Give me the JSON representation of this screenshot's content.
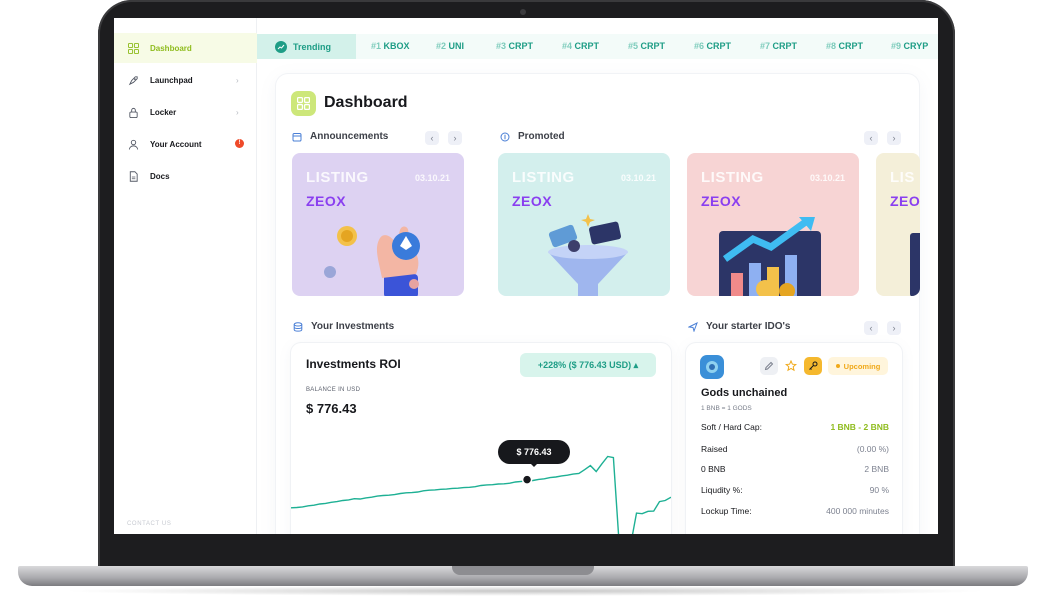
{
  "sidebar": {
    "items": [
      {
        "label": "Dashboard",
        "icon": "grid-icon",
        "active": true
      },
      {
        "label": "Launchpad",
        "icon": "rocket-icon",
        "chevron": "›"
      },
      {
        "label": "Locker",
        "icon": "lock-icon",
        "chevron": "›"
      },
      {
        "label": "Your Account",
        "icon": "user-icon",
        "badge": "!"
      },
      {
        "label": "Docs",
        "icon": "doc-icon"
      }
    ],
    "contact": "CONTACT US"
  },
  "trending": {
    "label": "Trending",
    "items": [
      {
        "rank": "#1",
        "name": "KBOX"
      },
      {
        "rank": "#2",
        "name": "UNI"
      },
      {
        "rank": "#3",
        "name": "CRPT"
      },
      {
        "rank": "#4",
        "name": "CRPT"
      },
      {
        "rank": "#5",
        "name": "CRPT"
      },
      {
        "rank": "#6",
        "name": "CRPT"
      },
      {
        "rank": "#7",
        "name": "CRPT"
      },
      {
        "rank": "#8",
        "name": "CRPT"
      },
      {
        "rank": "#9",
        "name": "CRYP"
      }
    ]
  },
  "page": {
    "title": "Dashboard"
  },
  "sections": {
    "announcements": "Announcements",
    "promoted": "Promoted",
    "investments": "Your Investments",
    "starter": "Your starter IDO's"
  },
  "nav": {
    "prev": "‹",
    "next": "›"
  },
  "cards": [
    {
      "listing": "LISTING",
      "date": "03.10.21",
      "brand": "ZEOX",
      "bg": "#ddd2f2"
    },
    {
      "listing": "LISTING",
      "date": "03.10.21",
      "brand": "ZEOX",
      "bg": "#d3efed"
    },
    {
      "listing": "LISTING",
      "date": "03.10.21",
      "brand": "ZEOX",
      "bg": "#f7d4d4"
    },
    {
      "listing": "LIS",
      "date": "",
      "brand": "ZEO",
      "bg": "#f4efd9"
    }
  ],
  "investments": {
    "title": "Investments ROI",
    "badge": "+228% ($ 776.43 USD) ▴",
    "balance_label": "BALANCE IN USD",
    "balance_value": "$ 776.43",
    "tooltip": "$ 776.43"
  },
  "chart_data": {
    "type": "line",
    "series": [
      {
        "values": [
          40,
          42,
          41,
          44,
          43,
          46,
          45,
          48,
          47,
          50,
          49,
          52,
          50,
          53,
          52,
          55,
          54,
          56,
          55,
          58,
          57,
          59,
          58,
          61,
          60,
          62,
          61,
          63,
          62,
          64,
          63,
          65,
          64,
          67,
          66,
          68,
          67,
          69,
          68,
          71,
          70,
          72,
          71,
          74,
          73,
          76,
          75,
          78,
          77,
          80,
          79,
          85,
          88,
          83,
          90,
          100,
          97,
          0,
          0,
          0,
          34,
          35,
          36,
          38,
          47,
          50,
          52
        ]
      }
    ],
    "highlight_index": 41,
    "highlight_label": "$ 776.43",
    "ylim": [
      0,
      100
    ],
    "grid": false,
    "color": "#1eb094"
  },
  "ido": {
    "name": "Gods unchained",
    "rate": "1 BNB = 1 GODS",
    "status": "Upcoming",
    "rows": [
      {
        "key": "Soft / Hard Cap:",
        "value": "1 BNB - 2 BNB",
        "accent": true
      },
      {
        "key": "Raised",
        "value": "(0.00 %)"
      },
      {
        "key": "0 BNB",
        "value": "2 BNB"
      },
      {
        "key": "Liqudity %:",
        "value": "90 %"
      },
      {
        "key": "Lockup Time:",
        "value": "400 000 minutes"
      }
    ]
  },
  "colors": {
    "accent_green": "#8fbc1e",
    "teal": "#1e9d86",
    "status_orange": "#f0a91a",
    "brand_purple": "#8a3ff0"
  }
}
